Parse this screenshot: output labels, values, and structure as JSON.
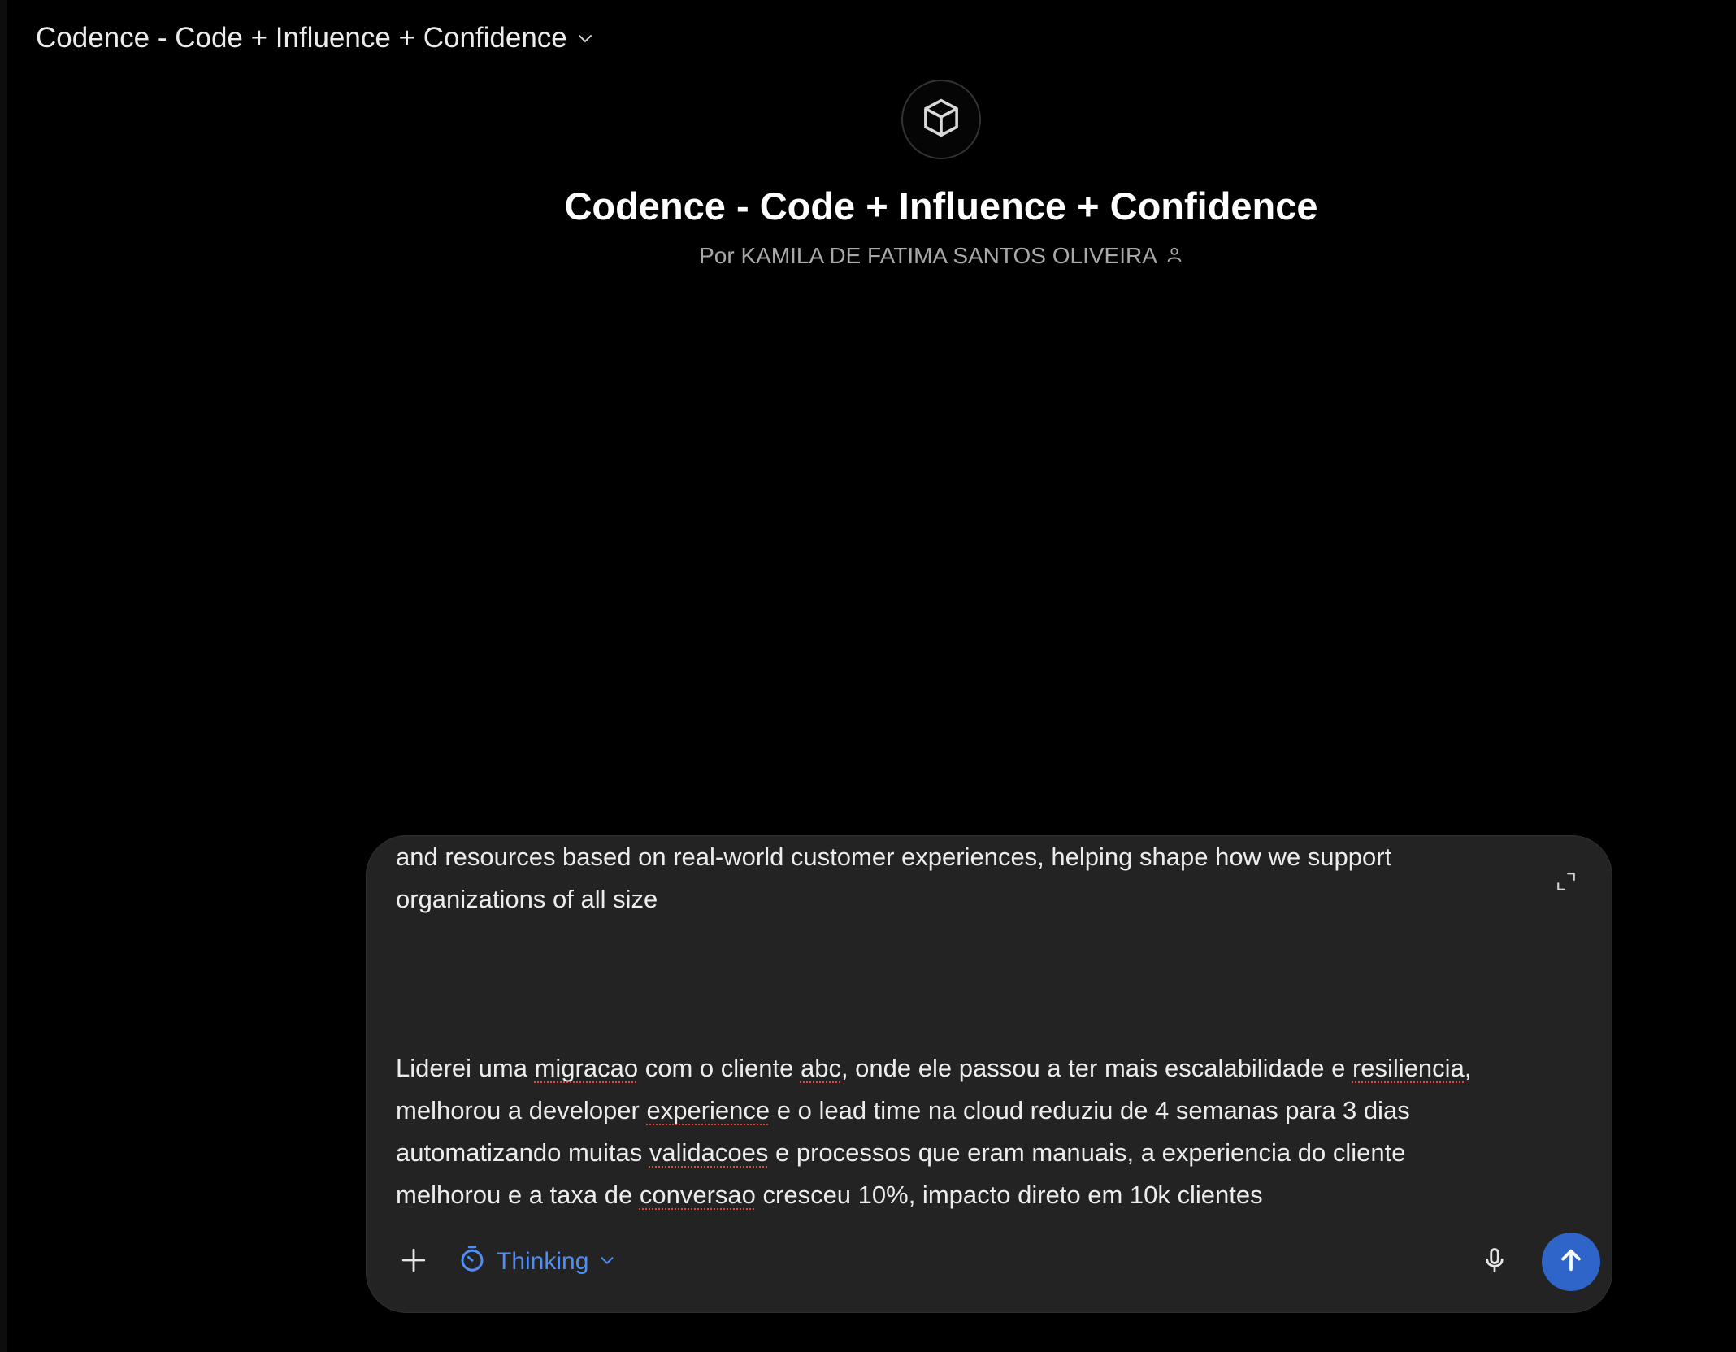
{
  "header": {
    "title": "Codence - Code + Influence + Confidence"
  },
  "gpt": {
    "icon": "cube-icon",
    "title": "Codence - Code + Influence + Confidence",
    "byline": "Por KAMILA DE FATIMA SANTOS OLIVEIRA"
  },
  "composer": {
    "paragraph1": {
      "line1": "and resources based on real-world customer experiences, helping shape how we support",
      "line2": "organizations of all size"
    },
    "paragraph2": {
      "l1_a": "Liderei uma ",
      "l1_b": "migracao",
      "l1_c": " com o cliente ",
      "l1_d": "abc",
      "l1_e": ", onde ele passou a ter mais escalabilidade e ",
      "l1_f": "resiliencia",
      "l1_g": ",",
      "l2_a": "melhorou a developer ",
      "l2_b": "experience",
      "l2_c": " e o lead time na cloud reduziu de 4 semanas para 3 dias",
      "l3_a": "automatizando muitas ",
      "l3_b": "validacoes",
      "l3_c": " e processos que eram manuais, a experiencia do cliente",
      "l4_a": "melhorou e a taxa de ",
      "l4_b": "conversao",
      "l4_c": " cresceu 10%, impacto direto em 10k clientes"
    },
    "thinking_label": "Thinking",
    "accent_color": "#4f8ef7",
    "send_color": "#2f64c8"
  }
}
